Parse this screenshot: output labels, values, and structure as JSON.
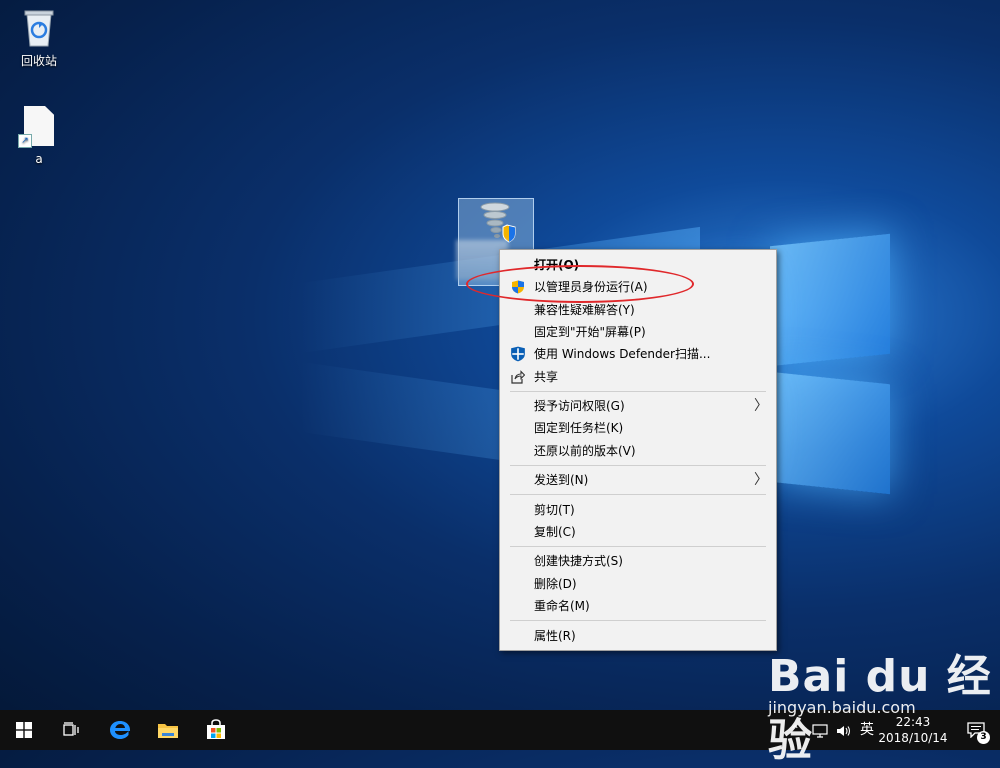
{
  "desktop": {
    "icons": [
      {
        "label": "回收站",
        "icon": "recycle-bin-icon"
      },
      {
        "label": "a",
        "icon": "file-shortcut-icon"
      }
    ]
  },
  "context_menu": {
    "items": [
      {
        "label": "打开(O)",
        "bold": true
      },
      {
        "label": "以管理员身份运行(A)",
        "icon": "uac-shield-icon"
      },
      {
        "label": "兼容性疑难解答(Y)"
      },
      {
        "label": "固定到\"开始\"屏幕(P)"
      },
      {
        "label": "使用 Windows Defender扫描...",
        "icon": "defender-shield-icon"
      },
      {
        "label": "共享",
        "icon": "share-icon"
      },
      {
        "label": "授予访问权限(G)",
        "submenu": true
      },
      {
        "label": "固定到任务栏(K)"
      },
      {
        "label": "还原以前的版本(V)"
      },
      {
        "label": "发送到(N)",
        "submenu": true
      },
      {
        "label": "剪切(T)"
      },
      {
        "label": "复制(C)"
      },
      {
        "label": "创建快捷方式(S)"
      },
      {
        "label": "删除(D)"
      },
      {
        "label": "重命名(M)"
      },
      {
        "label": "属性(R)"
      }
    ],
    "highlight_color": "#e0282b"
  },
  "taskbar": {
    "buttons": [
      "start-icon",
      "task-view-icon",
      "edge-icon",
      "file-explorer-icon",
      "store-icon"
    ],
    "tray": {
      "ime": "英",
      "time": "22:43",
      "date": "2018/10/14",
      "notification_count": "3"
    }
  },
  "watermark": {
    "logo": "Bai du 经验",
    "url": "jingyan.baidu.com"
  },
  "colors": {
    "accent": "#0078d7",
    "taskbar": "#101010",
    "menu_bg": "#f2f2f2"
  }
}
